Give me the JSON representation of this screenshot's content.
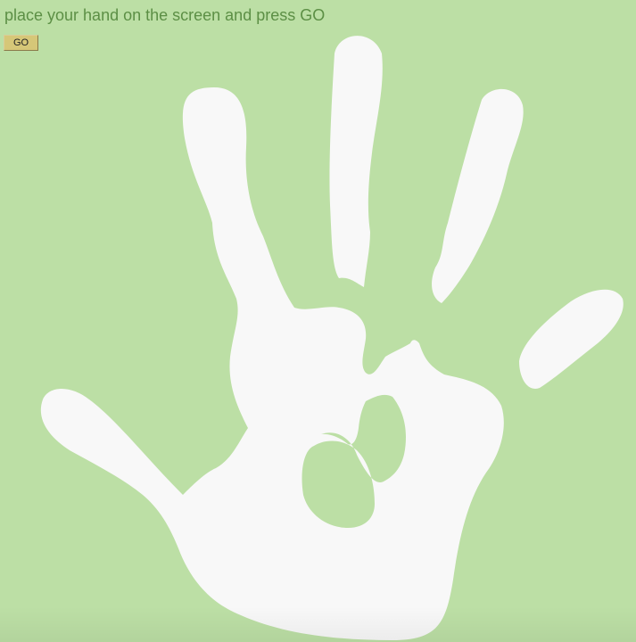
{
  "prompt": {
    "text": "place your hand on the screen and press GO"
  },
  "go_button": {
    "label": "GO"
  },
  "hand_print": {
    "icon": "hand-print-icon"
  },
  "colors": {
    "background": "#bcdfa5",
    "prompt_text": "#5c8f45",
    "hand": "#f8f8f8",
    "button_face": "#d6c778"
  }
}
